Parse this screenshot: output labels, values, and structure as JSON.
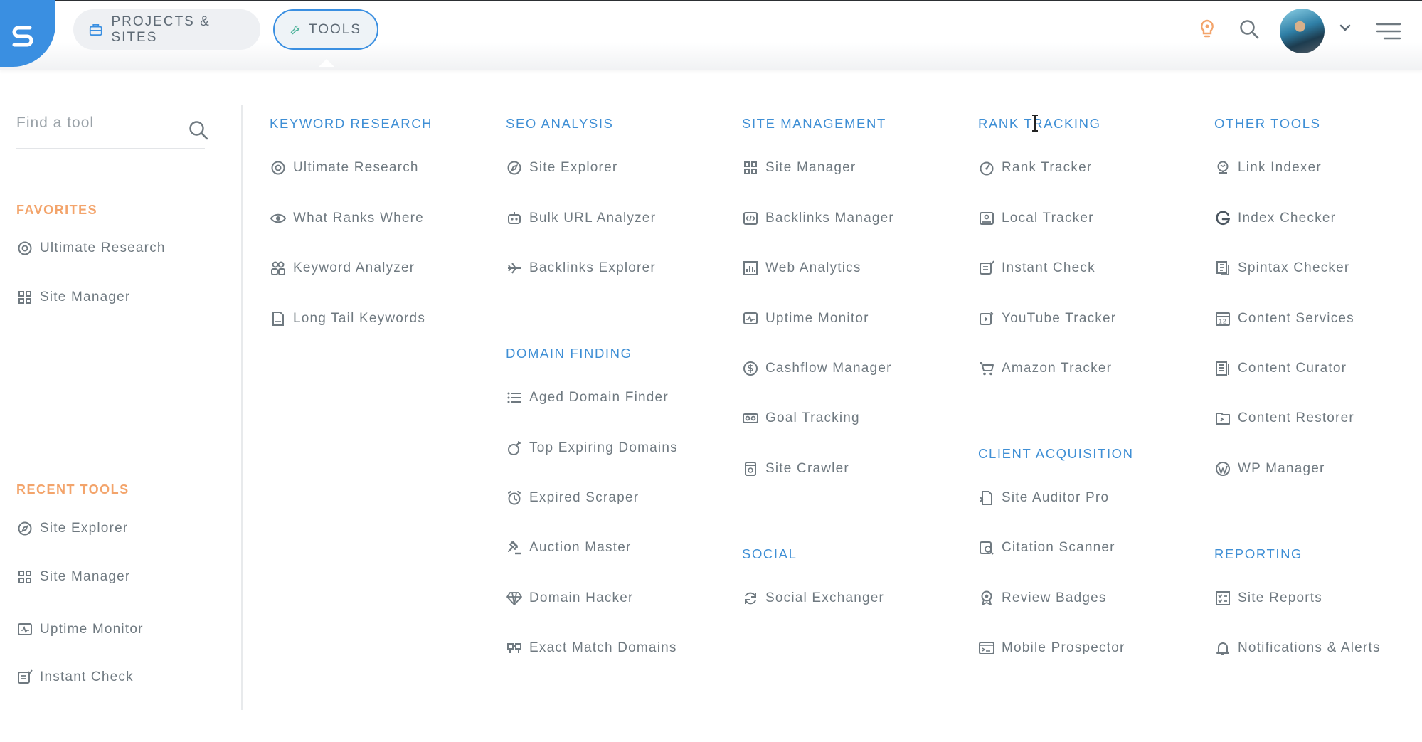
{
  "nav": {
    "projects_label": "PROJECTS & SITES",
    "tools_label": "TOOLS"
  },
  "search": {
    "placeholder": "Find a tool"
  },
  "favorites": {
    "heading": "FAVORITES",
    "items": [
      "Ultimate Research",
      "Site Manager"
    ]
  },
  "recent": {
    "heading": "RECENT TOOLS",
    "items": [
      "Site Explorer",
      "Site Manager",
      "Uptime Monitor",
      "Instant Check"
    ]
  },
  "sections": {
    "keyword_research": {
      "title": "KEYWORD RESEARCH",
      "items": [
        "Ultimate Research",
        "What Ranks Where",
        "Keyword Analyzer",
        "Long Tail Keywords"
      ]
    },
    "seo_analysis": {
      "title": "SEO ANALYSIS",
      "items": [
        "Site Explorer",
        "Bulk URL Analyzer",
        "Backlinks Explorer"
      ]
    },
    "domain_finding": {
      "title": "DOMAIN FINDING",
      "items": [
        "Aged Domain Finder",
        "Top Expiring Domains",
        "Expired Scraper",
        "Auction Master",
        "Domain Hacker",
        "Exact Match Domains"
      ]
    },
    "site_management": {
      "title": "SITE MANAGEMENT",
      "items": [
        "Site Manager",
        "Backlinks Manager",
        "Web Analytics",
        "Uptime Monitor",
        "Cashflow Manager",
        "Goal Tracking",
        "Site Crawler"
      ]
    },
    "social": {
      "title": "SOCIAL",
      "items": [
        "Social Exchanger"
      ]
    },
    "rank_tracking": {
      "title": "RANK TRACKING",
      "items": [
        "Rank Tracker",
        "Local Tracker",
        "Instant Check",
        "YouTube Tracker",
        "Amazon Tracker"
      ]
    },
    "client_acquisition": {
      "title": "CLIENT ACQUISITION",
      "items": [
        "Site Auditor Pro",
        "Citation Scanner",
        "Review Badges",
        "Mobile Prospector"
      ]
    },
    "other_tools": {
      "title": "OTHER TOOLS",
      "items": [
        "Link Indexer",
        "Index Checker",
        "Spintax Checker",
        "Content Services",
        "Content Curator",
        "Content Restorer",
        "WP Manager"
      ]
    },
    "reporting": {
      "title": "REPORTING",
      "items": [
        "Site Reports",
        "Notifications & Alerts"
      ]
    }
  },
  "colors": {
    "accent_blue": "#3a8fe1",
    "section_blue": "#3f8fd5",
    "orange_heading": "#f3a46b",
    "text_gray": "#6f7980"
  }
}
